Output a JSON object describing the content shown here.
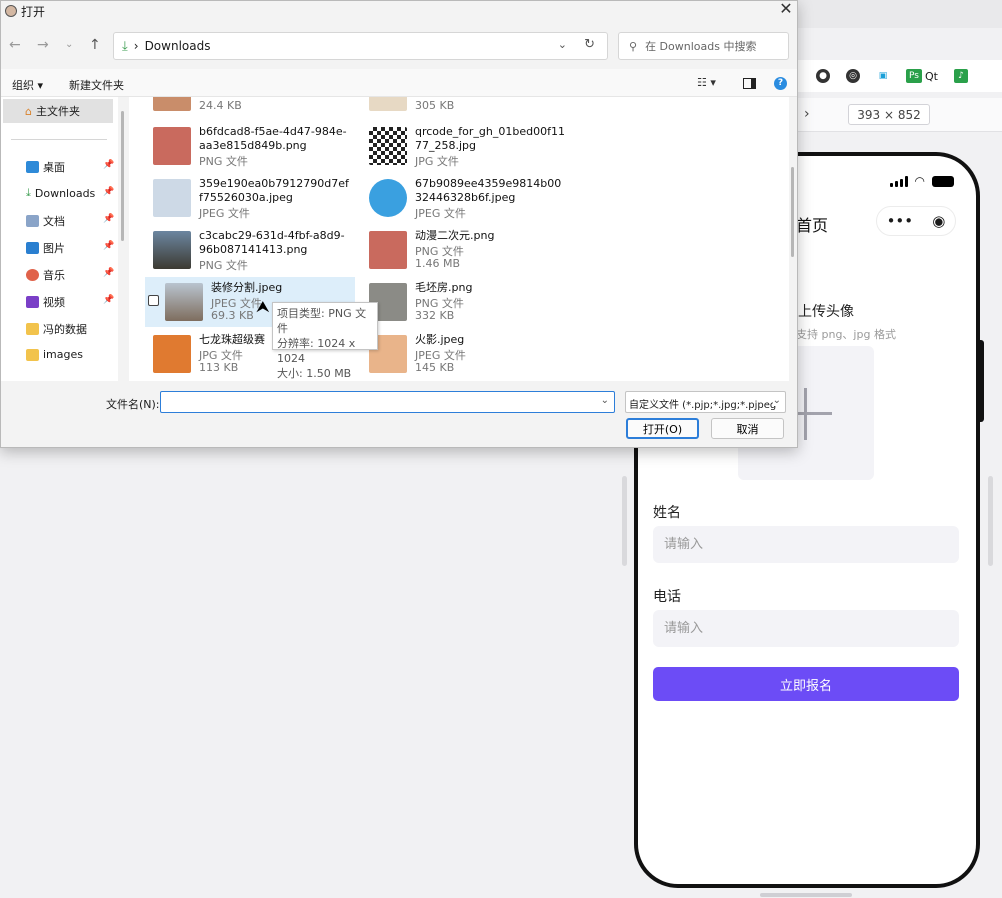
{
  "dialog": {
    "title": "打开",
    "address": {
      "folder": "Downloads",
      "separator": "›"
    },
    "search": {
      "placeholder": "在 Downloads 中搜索"
    },
    "toolbar": {
      "organize": "组织 ▾",
      "new_folder": "新建文件夹"
    },
    "nav_pane": {
      "home": "主文件夹",
      "items": [
        {
          "label": "桌面",
          "pinned": true
        },
        {
          "label": "Downloads",
          "pinned": true
        },
        {
          "label": "文档",
          "pinned": true
        },
        {
          "label": "图片",
          "pinned": true
        },
        {
          "label": "音乐",
          "pinned": true
        },
        {
          "label": "视频",
          "pinned": true
        },
        {
          "label": "冯的数据",
          "pinned": false
        },
        {
          "label": "images",
          "pinned": false
        }
      ]
    },
    "files": [
      {
        "name": "",
        "type": "",
        "size": "24.4 KB",
        "col": 0,
        "row": 0
      },
      {
        "name": "",
        "type": "",
        "size": "305 KB",
        "col": 1,
        "row": 0
      },
      {
        "name": "b6fdcad8-f5ae-4d47-984e-aa3e815d849b.png",
        "type": "PNG 文件",
        "size": "",
        "col": 0,
        "row": 1
      },
      {
        "name": "qrcode_for_gh_01bed00f1177_258.jpg",
        "type": "JPG 文件",
        "size": "",
        "col": 1,
        "row": 1
      },
      {
        "name": "359e190ea0b7912790d7eff75526030a.jpeg",
        "type": "JPEG 文件",
        "size": "",
        "col": 0,
        "row": 2
      },
      {
        "name": "67b9089ee4359e9814b0032446328b6f.jpeg",
        "type": "JPEG 文件",
        "size": "",
        "col": 1,
        "row": 2
      },
      {
        "name": "c3cabc29-631d-4fbf-a8d9-96b087141413.png",
        "type": "PNG 文件",
        "size": "",
        "col": 0,
        "row": 3
      },
      {
        "name": "动漫二次元.png",
        "type": "PNG 文件",
        "size": "1.46 MB",
        "col": 1,
        "row": 3
      },
      {
        "name": "装修分割.jpeg",
        "type": "JPEG 文件",
        "size": "69.3 KB",
        "col": 0,
        "row": 4,
        "selected": true
      },
      {
        "name": "毛坯房.png",
        "type": "PNG 文件",
        "size": "332 KB",
        "col": 1,
        "row": 4
      },
      {
        "name": "七龙珠超级赛",
        "type": "JPG 文件",
        "size": "113 KB",
        "col": 0,
        "row": 5
      },
      {
        "name": "火影.jpeg",
        "type": "JPEG 文件",
        "size": "145 KB",
        "col": 1,
        "row": 5
      }
    ],
    "tooltip": {
      "line1": "项目类型: PNG 文件",
      "line2": "分辨率: 1024 x 1024",
      "line3": "大小: 1.50 MB"
    },
    "filename_label": "文件名(N):",
    "filename_value": "",
    "filetype": "自定义文件 (*.pjp;*.jpg;*.pjpeg",
    "open_button": "打开(O)",
    "cancel_button": "取消"
  },
  "browser": {
    "extensions": [
      "Qt"
    ],
    "dimensions": "393 × 852"
  },
  "phone": {
    "page_title": "首页",
    "avatar_label": "上传头像",
    "avatar_hint": "支持 png、jpg 格式",
    "fields": [
      {
        "label": "姓名",
        "placeholder": "请输入"
      },
      {
        "label": "电话",
        "placeholder": "请输入"
      }
    ],
    "submit_label": "立即报名",
    "accent_color": "#6c4cf6"
  }
}
